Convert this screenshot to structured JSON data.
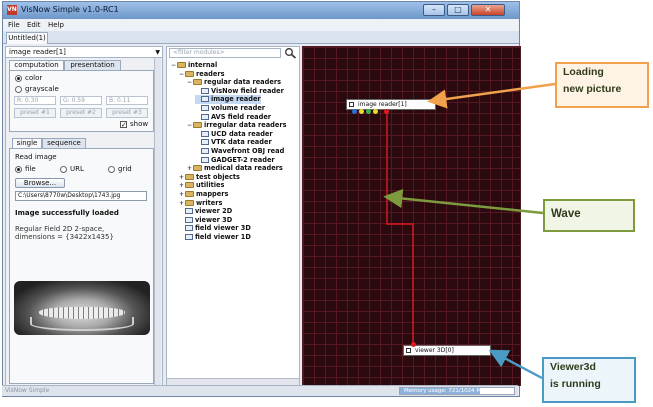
{
  "window": {
    "title": "VisNow Simple v1.0-RC1",
    "app_icon": "VN",
    "buttons": {
      "minimize": "–",
      "maximize": "□",
      "close": "✕"
    }
  },
  "menu": [
    "File",
    "Edit",
    "Help"
  ],
  "document_tab": "Untitled(1)",
  "left_panel": {
    "module_name": "image reader[1]",
    "top_tabs": [
      "computation",
      "presentation"
    ],
    "color_option": "color",
    "grayscale_option": "grayscale",
    "rgb_fields": [
      "R: 0.30",
      "G: 0.59",
      "B: 0.11"
    ],
    "presets": [
      "preset #1",
      "preset #2",
      "preset #3"
    ],
    "show_label": "show",
    "show_checked": true,
    "sub_tabs": [
      "single",
      "sequence"
    ],
    "read_image_label": "Read image",
    "source_options": [
      "file",
      "URL",
      "grid"
    ],
    "browse_button": "Browse...",
    "file_path": "C:\\Users\\8770w\\Desktop\\1743.jpg",
    "status_message": "Image successfully loaded",
    "field_info_line1": "Regular Field 2D 2-space,",
    "field_info_line2": "dimensions = {3422x1435}"
  },
  "module_tree": {
    "filter_placeholder": "<filter modules>",
    "rows": [
      {
        "label": "internal",
        "kind": "folder",
        "exp": "−"
      },
      {
        "label": "readers",
        "kind": "folder",
        "exp": "−"
      },
      {
        "label": "regular data readers",
        "kind": "folder",
        "exp": "−"
      },
      {
        "label": "VisNow field reader",
        "kind": "module",
        "exp": ""
      },
      {
        "label": "image reader",
        "kind": "module",
        "exp": ""
      },
      {
        "label": "volume reader",
        "kind": "module",
        "exp": ""
      },
      {
        "label": "AVS field reader",
        "kind": "module",
        "exp": ""
      },
      {
        "label": "irregular data readers",
        "kind": "folder",
        "exp": "−"
      },
      {
        "label": "UCD data reader",
        "kind": "module",
        "exp": ""
      },
      {
        "label": "VTK data reader",
        "kind": "module",
        "exp": ""
      },
      {
        "label": "Wavefront OBJ read",
        "kind": "module",
        "exp": ""
      },
      {
        "label": "GADGET-2 reader",
        "kind": "module",
        "exp": ""
      },
      {
        "label": "medical data readers",
        "kind": "folder",
        "exp": "+"
      },
      {
        "label": "test objects",
        "kind": "folder",
        "exp": "+"
      },
      {
        "label": "utilities",
        "kind": "folder",
        "exp": "+"
      },
      {
        "label": "mappers",
        "kind": "folder",
        "exp": "+"
      },
      {
        "label": "writers",
        "kind": "folder",
        "exp": "+"
      },
      {
        "label": "viewer 2D",
        "kind": "module",
        "exp": ""
      },
      {
        "label": "viewer 3D",
        "kind": "module",
        "exp": ""
      },
      {
        "label": "field viewer 3D",
        "kind": "module",
        "exp": ""
      },
      {
        "label": "field viewer 1D",
        "kind": "module",
        "exp": ""
      }
    ]
  },
  "canvas": {
    "node_source": "image reader[1]",
    "node_target": "viewer 3D[0]"
  },
  "status_bar": {
    "left": "VisNow Simple",
    "memory": "Memory usage: 721/1024 MB (70.0%)",
    "memory_fraction": 0.7
  },
  "callouts": {
    "loading_line1": "Loading",
    "loading_line2": "new picture",
    "wave": "Wave",
    "viewer_line1": "Viewer3d",
    "viewer_line2": "is running"
  },
  "colors": {
    "canvas_bg": "#2a0a0f",
    "connection": "#e0191e",
    "callout_loading": "#f1a14b",
    "callout_wave": "#7d9a3c",
    "callout_viewer": "#4a9bc4"
  }
}
